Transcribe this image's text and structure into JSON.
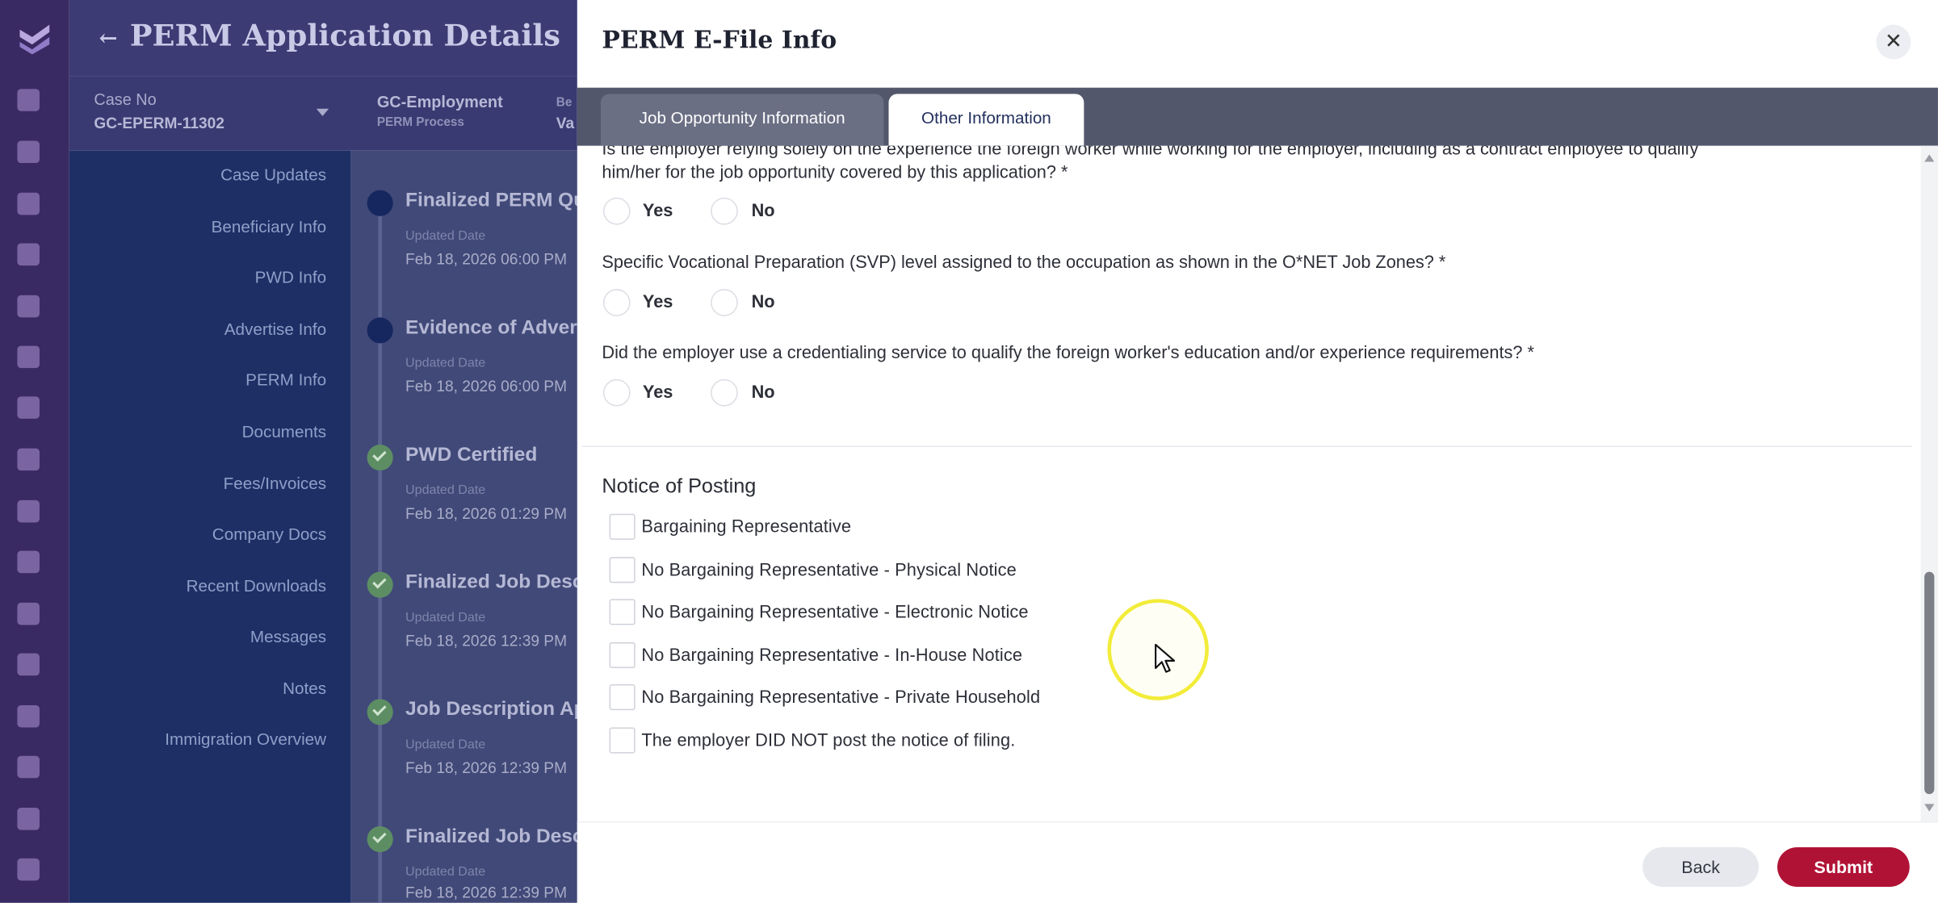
{
  "background": {
    "page_title": "PERM Application Details",
    "back_arrow": "←",
    "case_no_label": "Case No",
    "case_no_value": "GC-EPERM-11302",
    "process_label": "GC-Employment",
    "process_sub": "PERM Process",
    "extra_label_1": "Be",
    "extra_label_2": "Va",
    "nav_items": [
      "Case Updates",
      "Beneficiary Info",
      "PWD Info",
      "Advertise Info",
      "PERM Info",
      "Documents",
      "Fees/Invoices",
      "Company Docs",
      "Recent Downloads",
      "Messages",
      "Notes",
      "Immigration Overview"
    ],
    "timeline": [
      {
        "title": "Finalized PERM Qu",
        "label": "Updated Date",
        "date": "Feb 18, 2026 06:00 PM",
        "status": "current"
      },
      {
        "title": "Evidence of Advert",
        "label": "Updated Date",
        "date": "Feb 18, 2026 06:00 PM",
        "status": "current"
      },
      {
        "title": "PWD Certified",
        "label": "Updated Date",
        "date": "Feb 18, 2026 01:29 PM",
        "status": "done"
      },
      {
        "title": "Finalized Job Desc",
        "label": "Updated Date",
        "date": "Feb 18, 2026 12:39 PM",
        "status": "done"
      },
      {
        "title": "Job Description Ap",
        "label": "Updated Date",
        "date": "Feb 18, 2026 12:39 PM",
        "status": "done"
      },
      {
        "title": "Finalized Job Desc",
        "label": "Updated Date",
        "date": "Feb 18, 2026 12:39 PM",
        "status": "done"
      }
    ]
  },
  "modal": {
    "title": "PERM E-File Info",
    "close_symbol": "✕",
    "tabs": [
      {
        "label": "Job Opportunity Information",
        "active": false
      },
      {
        "label": "Other Information",
        "active": true
      }
    ],
    "questions": [
      {
        "line1": "Is the employer relying solely on the experience the foreign worker while working for the employer, including as a contract employee to qualify",
        "line2": "him/her for the job opportunity covered by this application? *",
        "yes": "Yes",
        "no": "No"
      },
      {
        "line1": "Specific Vocational Preparation (SVP) level assigned to the occupation as shown in the O*NET Job Zones? *",
        "yes": "Yes",
        "no": "No"
      },
      {
        "line1": "Did the employer use a credentialing service to qualify the foreign worker's education and/or experience requirements? *",
        "yes": "Yes",
        "no": "No"
      }
    ],
    "notice_section_title": "Notice of Posting",
    "notice_options": [
      "Bargaining Representative",
      "No Bargaining Representative - Physical Notice",
      "No Bargaining Representative - Electronic Notice",
      "No Bargaining Representative - In-House Notice",
      "No Bargaining Representative - Private Household",
      "The employer DID NOT post the notice of filing."
    ],
    "buttons": {
      "back": "Back",
      "submit": "Submit"
    }
  },
  "colors": {
    "submit": "#b01235",
    "tab_bar": "#52576b",
    "nav_bg": "#1e2f66",
    "rail_bg": "#3a2a63",
    "cursor_highlight": "#f2ec3a"
  }
}
